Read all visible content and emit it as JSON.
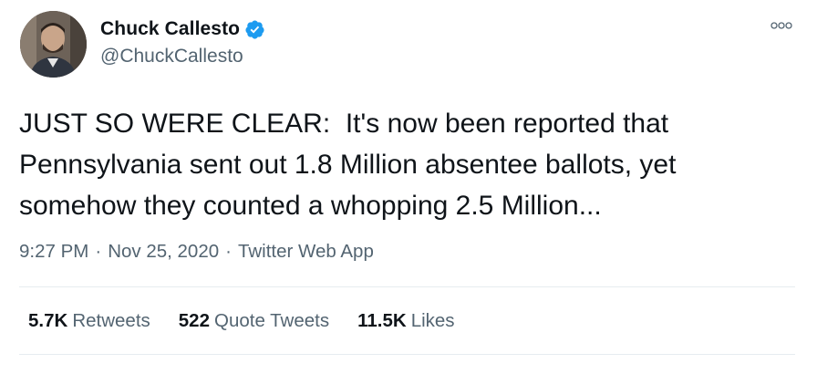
{
  "author": {
    "display_name": "Chuck Callesto",
    "handle": "@ChuckCallesto",
    "verified_icon": "verified-badge-icon",
    "badge_color": "#1d9bf0"
  },
  "more_icon": "more-options-icon",
  "tweet": {
    "text": "JUST SO WERE CLEAR:  It's now been reported that\nPennsylvania sent out 1.8 Million absentee ballots, yet\nsomehow they counted a whopping 2.5 Million..."
  },
  "meta": {
    "time": "9:27 PM",
    "separator": "·",
    "date": "Nov 25, 2020",
    "source": "Twitter Web App"
  },
  "stats": [
    {
      "count": "5.7K",
      "label": "Retweets"
    },
    {
      "count": "522",
      "label": "Quote Tweets"
    },
    {
      "count": "11.5K",
      "label": "Likes"
    }
  ]
}
